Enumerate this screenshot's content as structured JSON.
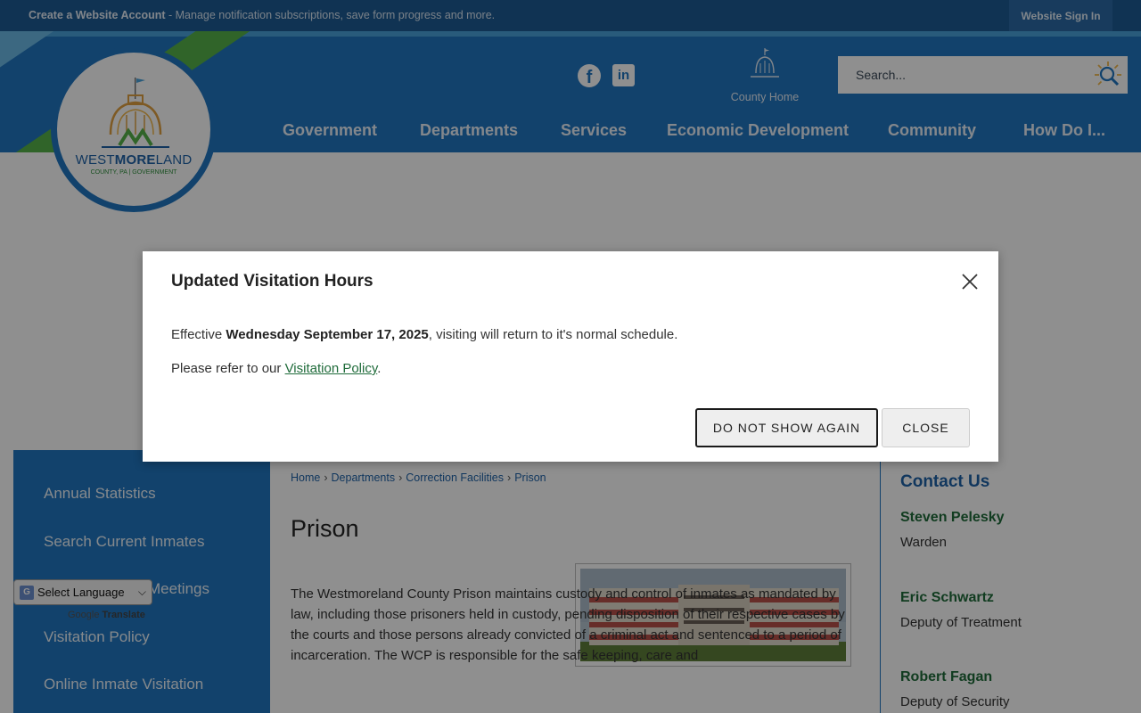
{
  "top_bar": {
    "create_account_link": "Create a Website Account",
    "create_account_desc": " - Manage notification subscriptions, save form progress and more.",
    "sign_in": "Website Sign In"
  },
  "logo": {
    "name_part1": "WEST",
    "name_part2": "MORE",
    "name_part3": "LAND",
    "subtitle": "COUNTY, PA | GOVERNMENT"
  },
  "header": {
    "social_icons": [
      "facebook-icon",
      "linkedin-icon"
    ],
    "county_home": "County Home",
    "search_placeholder": "Search..."
  },
  "nav": [
    {
      "label": "Government"
    },
    {
      "label": "Departments"
    },
    {
      "label": "Services"
    },
    {
      "label": "Economic Development"
    },
    {
      "label": "Community"
    },
    {
      "label": "How Do I..."
    }
  ],
  "left_sidebar": {
    "items": [
      {
        "label": "Annual Statistics"
      },
      {
        "label": "Search Current Inmates"
      },
      {
        "label": "Meetings"
      },
      {
        "label": "Visitation Policy"
      },
      {
        "label": "Online Inmate Visitation"
      }
    ]
  },
  "translate": {
    "select_label": "Select Language",
    "powered_by": "Google",
    "translate_word": "Translate"
  },
  "breadcrumb": [
    {
      "label": "Home"
    },
    {
      "label": "Departments"
    },
    {
      "label": "Correction Facilities"
    },
    {
      "label": "Prison"
    }
  ],
  "page": {
    "title": "Prison",
    "body_text": "The Westmoreland County Prison maintains custody and control of inmates as mandated by law, including those prisoners held in custody, pending disposition of their respective cases by the courts and those persons already convicted of a criminal act and sentenced to a period of incarceration. The WCP is responsible for the safe keeping, care and"
  },
  "contact": {
    "title": "Contact Us",
    "people": [
      {
        "name": "Steven Pelesky",
        "role": "Warden"
      },
      {
        "name": "Eric Schwartz",
        "role": "Deputy of Treatment"
      },
      {
        "name": "Robert Fagan",
        "role": "Deputy of Security"
      }
    ]
  },
  "modal": {
    "title": "Updated Visitation Hours",
    "line1_prefix": "Effective ",
    "line1_bold": "Wednesday September 17, 2025",
    "line1_suffix": ", visiting will return to it's normal schedule.",
    "line2_prefix": "Please refer to our ",
    "line2_link": "Visitation Policy",
    "line2_suffix": ".",
    "btn_dont_show": "DO NOT SHOW AGAIN",
    "btn_close": "CLOSE"
  },
  "colors": {
    "brand_blue": "#2176c1",
    "dark_blue": "#1d5b95",
    "accent_green": "#57b24a",
    "link_green": "#1f6b3a"
  }
}
